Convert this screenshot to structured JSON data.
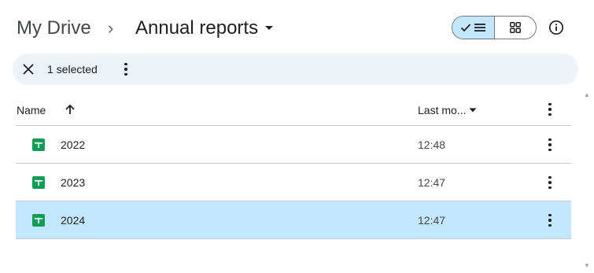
{
  "breadcrumb": {
    "root": "My Drive",
    "separator": "›",
    "current": "Annual reports"
  },
  "view_toggle": {
    "active": "list"
  },
  "selection_bar": {
    "count_text": "1 selected"
  },
  "table": {
    "headers": {
      "name": "Name",
      "modified": "Last mo..."
    },
    "rows": [
      {
        "name": "2022",
        "modified": "12:48",
        "selected": false
      },
      {
        "name": "2023",
        "modified": "12:47",
        "selected": false
      },
      {
        "name": "2024",
        "modified": "12:47",
        "selected": true
      }
    ]
  },
  "colors": {
    "selected_row": "#c2e7ff",
    "selection_bar": "#eef2f9",
    "sheets_icon": "#0f9d58"
  },
  "icons": {
    "sort": "arrow-up-icon",
    "close": "close-icon",
    "more": "more-vert-icon",
    "file": "google-sheets-icon",
    "info": "info-icon"
  }
}
